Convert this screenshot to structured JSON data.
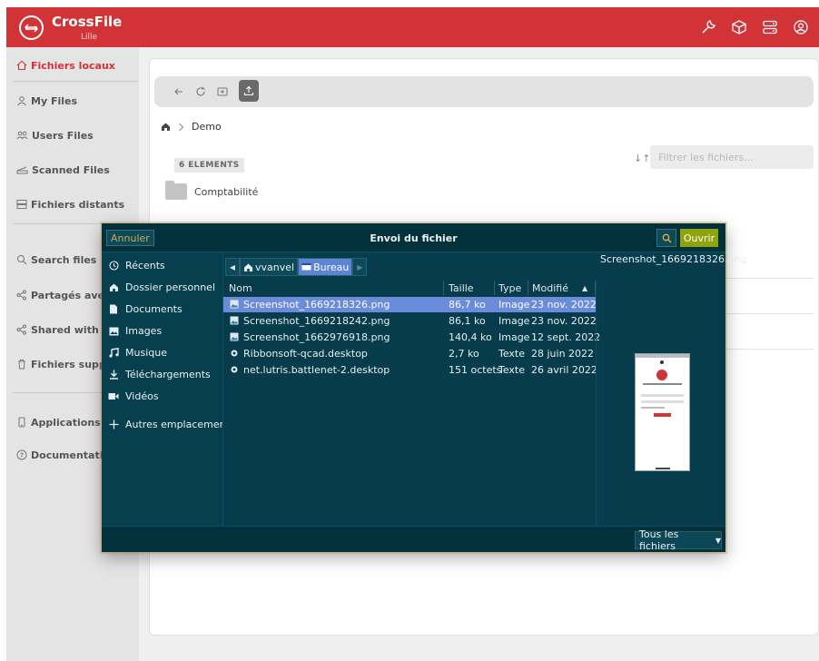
{
  "app": {
    "name": "CrossFile",
    "location": "Lille"
  },
  "topbar": {
    "icons": [
      "wrench-icon",
      "cube-icon",
      "server-icon",
      "account-icon"
    ]
  },
  "sidebar": {
    "items": [
      {
        "label": "Fichiers locaux",
        "icon": "home-icon",
        "active": true
      },
      {
        "label": "My Files",
        "icon": "user-icon"
      },
      {
        "label": "Users Files",
        "icon": "users-icon"
      },
      {
        "label": "Scanned Files",
        "icon": "scanner-icon"
      },
      {
        "label": "Fichiers distants",
        "icon": "server-icon"
      },
      {
        "label": "Search files",
        "icon": "search-icon"
      },
      {
        "label": "Partagés avec d'a",
        "icon": "share-icon"
      },
      {
        "label": "Shared with me",
        "icon": "share-icon"
      },
      {
        "label": "Fichiers supprimé",
        "icon": "trash-icon"
      },
      {
        "label": "Applications Mobi",
        "icon": "mobile-icon"
      },
      {
        "label": "Documentation",
        "icon": "help-icon"
      }
    ]
  },
  "toolbar": {
    "buttons": [
      "back-icon",
      "refresh-icon",
      "new-folder-icon",
      "upload-icon"
    ]
  },
  "breadcrumb": {
    "current": "Demo"
  },
  "files": {
    "count_label": "6 ELEMENTS",
    "filter_placeholder": "Filtrer les fichiers...",
    "folders": [
      "Comptabilité"
    ]
  },
  "dialog": {
    "title": "Envoi du fichier",
    "cancel_label": "Annuler",
    "open_label": "Ouvrir",
    "places": [
      {
        "label": "Récents",
        "icon": "clock-icon"
      },
      {
        "label": "Dossier personnel",
        "icon": "home-icon"
      },
      {
        "label": "Documents",
        "icon": "document-icon"
      },
      {
        "label": "Images",
        "icon": "image-icon"
      },
      {
        "label": "Musique",
        "icon": "music-icon"
      },
      {
        "label": "Téléchargements",
        "icon": "download-icon"
      },
      {
        "label": "Vidéos",
        "icon": "video-icon"
      },
      {
        "label": "Autres emplacements",
        "icon": "plus-icon"
      }
    ],
    "path": [
      "vvanvel",
      "Bureau"
    ],
    "columns": {
      "name": "Nom",
      "size": "Taille",
      "type": "Type",
      "modified": "Modifié"
    },
    "rows": [
      {
        "name": "Screenshot_1669218326.png",
        "size": "86,7 ko",
        "type": "Image",
        "modified": "23 nov. 2022",
        "selected": true
      },
      {
        "name": "Screenshot_1669218242.png",
        "size": "86,1 ko",
        "type": "Image",
        "modified": "23 nov. 2022"
      },
      {
        "name": "Screenshot_1662976918.png",
        "size": "140,4 ko",
        "type": "Image",
        "modified": "12 sept. 2022"
      },
      {
        "name": "Ribbonsoft-qcad.desktop",
        "size": "2,7 ko",
        "type": "Texte",
        "modified": "28 juin 2022"
      },
      {
        "name": "net.lutris.battlenet-2.desktop",
        "size": "151 octets",
        "type": "Texte",
        "modified": "26 avril 2022"
      }
    ],
    "preview": {
      "filename": "Screenshot_1669218326.png"
    },
    "filetype_label": "Tous les fichiers"
  }
}
